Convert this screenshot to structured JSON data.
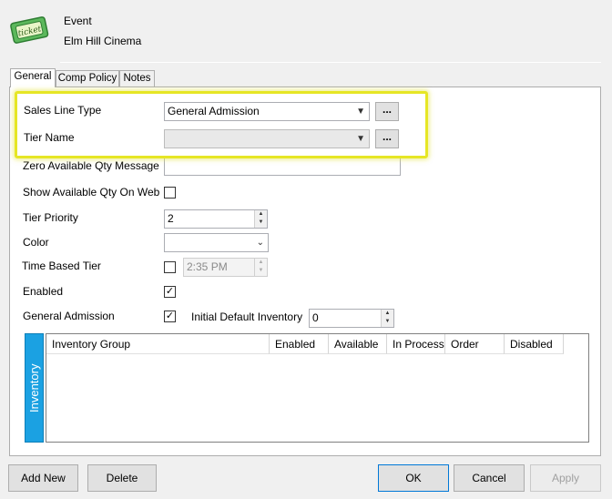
{
  "header": {
    "icon": "ticket-icon",
    "type_label": "Event",
    "name": "Elm Hill Cinema"
  },
  "tabs": [
    {
      "label": "General",
      "active": true
    },
    {
      "label": "Comp Policy",
      "active": false
    },
    {
      "label": "Notes",
      "active": false
    }
  ],
  "form": {
    "sales_line_type": {
      "label": "Sales Line Type",
      "value": "General Admission"
    },
    "tier_name": {
      "label": "Tier Name",
      "value": ""
    },
    "ellipsis_label": "...",
    "zero_qty_message": {
      "label": "Zero Available Qty Message",
      "value": ""
    },
    "show_qty_on_web": {
      "label": "Show Available Qty On Web",
      "checked": false
    },
    "tier_priority": {
      "label": "Tier Priority",
      "value": "2"
    },
    "color": {
      "label": "Color",
      "value": ""
    },
    "time_based_tier": {
      "label": "Time Based Tier",
      "checked": false,
      "time": "2:35 PM"
    },
    "enabled": {
      "label": "Enabled",
      "checked": true
    },
    "general_admission": {
      "label": "General Admission",
      "checked": true
    },
    "initial_default_inventory": {
      "label": "Initial Default Inventory",
      "value": "0"
    }
  },
  "inventory": {
    "side_label": "Inventory",
    "columns": [
      "Inventory Group",
      "Enabled",
      "Available",
      "In Process",
      "Order",
      "Disabled"
    ]
  },
  "buttons": {
    "add_new": "Add New",
    "delete": "Delete",
    "ok": "OK",
    "cancel": "Cancel",
    "apply": "Apply"
  },
  "colors": {
    "highlight": "#e6e625",
    "inventory_accent": "#1ba1e2",
    "primary_border": "#0078d7"
  }
}
